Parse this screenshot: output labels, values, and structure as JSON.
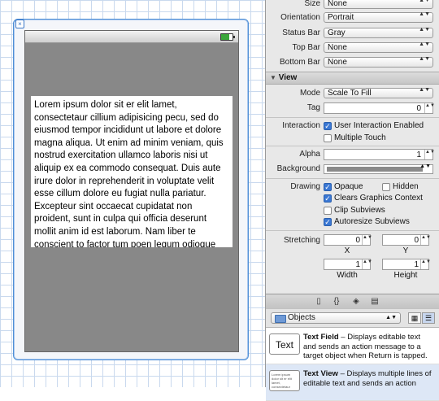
{
  "canvas": {
    "text_view_content": "Lorem ipsum dolor sit er elit lamet, consectetaur cillium adipisicing pecu, sed do eiusmod tempor incididunt ut labore et dolore magna aliqua. Ut enim ad minim veniam, quis nostrud exercitation ullamco laboris nisi ut aliquip ex ea commodo consequat. Duis aute irure dolor in reprehenderit in voluptate velit esse cillum dolore eu fugiat nulla pariatur. Excepteur sint occaecat cupidatat non proident, sunt in culpa qui officia deserunt mollit anim id est laborum. Nam liber te conscient to factor tum poen legum odioque civiuda.",
    "close_glyph": "×"
  },
  "simulated_metrics": {
    "size": {
      "label": "Size",
      "value": "None"
    },
    "orientation": {
      "label": "Orientation",
      "value": "Portrait"
    },
    "status_bar": {
      "label": "Status Bar",
      "value": "Gray"
    },
    "top_bar": {
      "label": "Top Bar",
      "value": "None"
    },
    "bottom_bar": {
      "label": "Bottom Bar",
      "value": "None"
    }
  },
  "view_section": {
    "title": "View",
    "mode": {
      "label": "Mode",
      "value": "Scale To Fill"
    },
    "tag": {
      "label": "Tag",
      "value": "0"
    },
    "interaction": {
      "label": "Interaction",
      "user_interaction": {
        "label": "User Interaction Enabled",
        "checked": true
      },
      "multiple_touch": {
        "label": "Multiple Touch",
        "checked": false
      }
    },
    "alpha": {
      "label": "Alpha",
      "value": "1"
    },
    "background": {
      "label": "Background",
      "color": "#8a8a8a"
    },
    "drawing": {
      "label": "Drawing",
      "opaque": {
        "label": "Opaque",
        "checked": true
      },
      "hidden": {
        "label": "Hidden",
        "checked": false
      },
      "clears_graphics_context": {
        "label": "Clears Graphics Context",
        "checked": true
      },
      "clip_subviews": {
        "label": "Clip Subviews",
        "checked": false
      },
      "autoresize_subviews": {
        "label": "Autoresize Subviews",
        "checked": true
      }
    },
    "stretching": {
      "label": "Stretching",
      "x": {
        "label": "X",
        "value": "0"
      },
      "y": {
        "label": "Y",
        "value": "0"
      },
      "width": {
        "label": "Width",
        "value": "1"
      },
      "height": {
        "label": "Height",
        "value": "1"
      }
    }
  },
  "library": {
    "popup_value": "Objects",
    "items": [
      {
        "icon_text": "Text",
        "name": "Text Field",
        "description": " – Displays editable text and sends an action message to a target object when Return is tapped."
      },
      {
        "icon_text": "Lorem ipsum dolor sit er elit lamet, consectetaur",
        "name": "Text View",
        "description": " – Displays multiple lines of editable text and sends an action"
      }
    ]
  },
  "glyphs": {
    "up_down": "▲▼",
    "check": "✓",
    "disclosure": "▼"
  }
}
